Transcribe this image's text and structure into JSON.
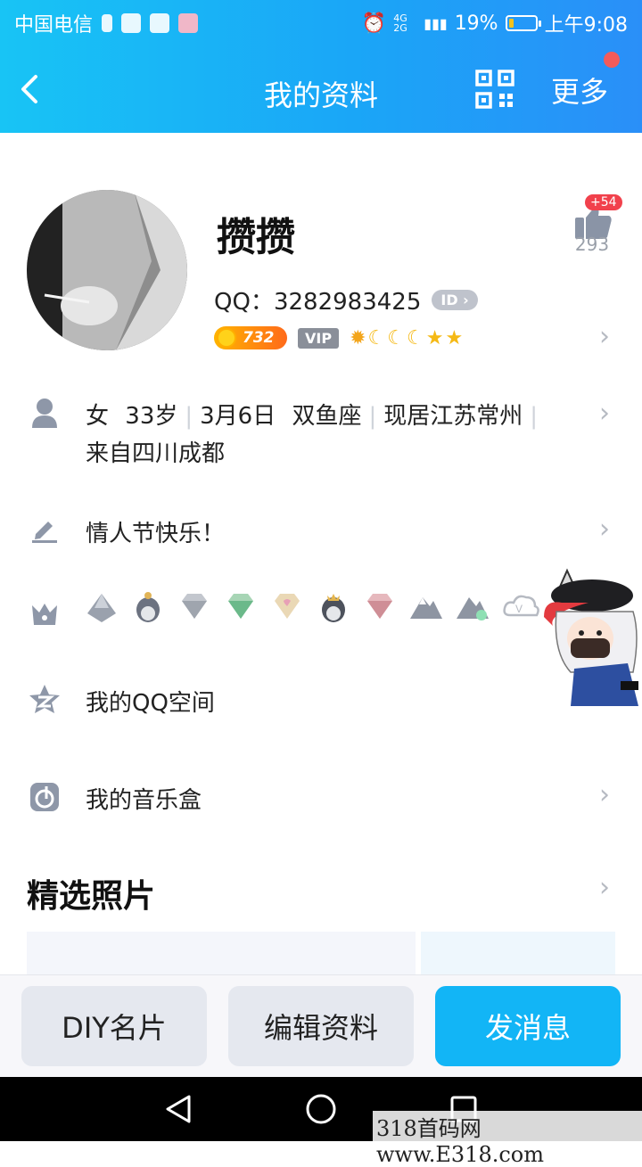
{
  "status_bar": {
    "carrier": "中国电信",
    "network": "4G 2G",
    "battery": "19%",
    "battery_level": 0.19,
    "time": "上午9:08"
  },
  "header": {
    "title": "我的资料",
    "more_label": "更多"
  },
  "profile": {
    "nickname": "攒攒",
    "qq_label": "QQ：",
    "qq_number": "3282983425",
    "id_badge": "ID",
    "coin_value": "732",
    "vip_label": "VIP",
    "likes_badge": "+54",
    "likes_count": "293"
  },
  "info": {
    "gender": "女",
    "age": "33岁",
    "birthday": "3月6日",
    "zodiac": "双鱼座",
    "location": "现居江苏常州",
    "hometown": "来自四川成都"
  },
  "signature": "情人节快乐！",
  "links": {
    "qzone": "我的QQ空间",
    "music_box": "我的音乐盒"
  },
  "photos_section_title": "精选照片",
  "buttons": {
    "diy": "DIY名片",
    "edit": "编辑资料",
    "send": "发消息"
  },
  "watermark": "318首码网 www.E318.com",
  "colors": {
    "header_start": "#18c4f5",
    "header_end": "#2a8ff8",
    "primary_button": "#12b5f6",
    "badge_red": "#f1414c"
  }
}
